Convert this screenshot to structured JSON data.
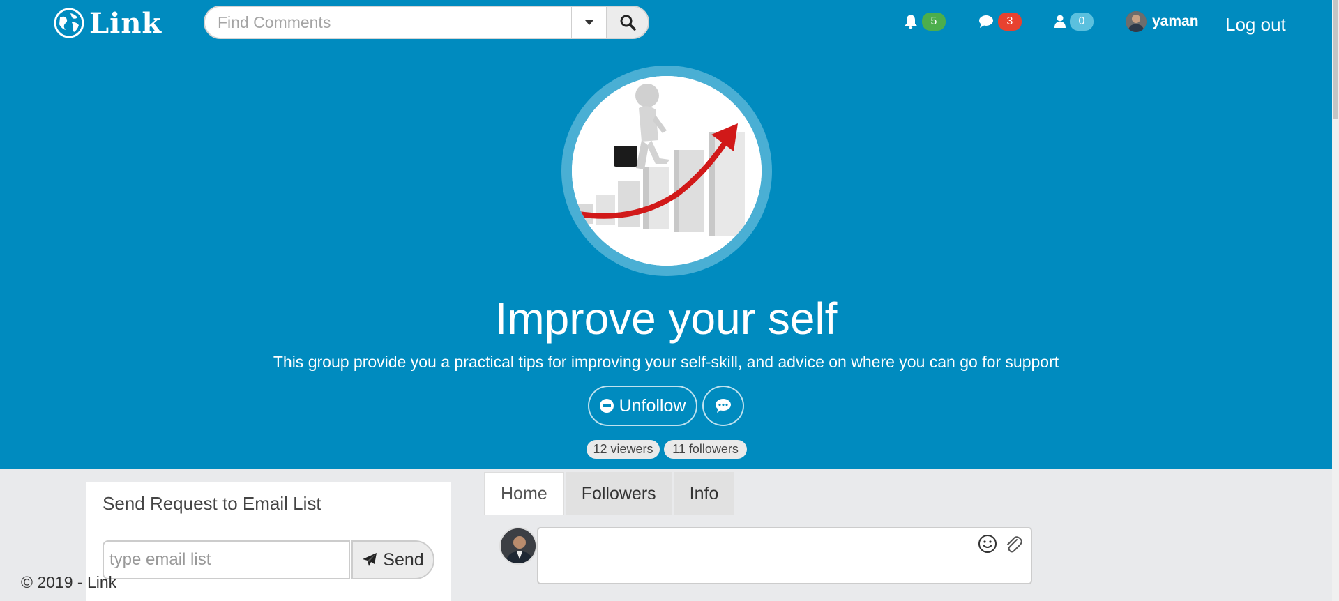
{
  "header": {
    "logo_text": "Link",
    "search_placeholder": "Find Comments",
    "notifications_count": "5",
    "messages_count": "3",
    "friends_count": "0",
    "username": "yaman",
    "logout_label": "Log out"
  },
  "group": {
    "title": "Improve your self",
    "description": "This group provide you a practical tips for improving your self-skill, and advice on where you can go for support",
    "unfollow_label": "Unfollow",
    "viewers": "12 viewers",
    "followers": "11 followers"
  },
  "email_card": {
    "title": "Send Request to Email List",
    "input_placeholder": "type email list",
    "send_label": "Send"
  },
  "tabs": [
    {
      "label": "Home"
    },
    {
      "label": "Followers"
    },
    {
      "label": "Info"
    }
  ],
  "footer": {
    "copyright": "© 2019 - Link"
  },
  "colors": {
    "hero_bg": "#008bbf",
    "badge_green": "#4cae4c",
    "badge_red": "#e8422f",
    "badge_blue": "#5bc0de"
  },
  "icons": [
    "globe-icon",
    "caret-down-icon",
    "search-icon",
    "bell-icon",
    "comment-icon",
    "user-icon",
    "minus-circle-icon",
    "paper-plane-icon",
    "smiley-icon",
    "paperclip-icon"
  ]
}
